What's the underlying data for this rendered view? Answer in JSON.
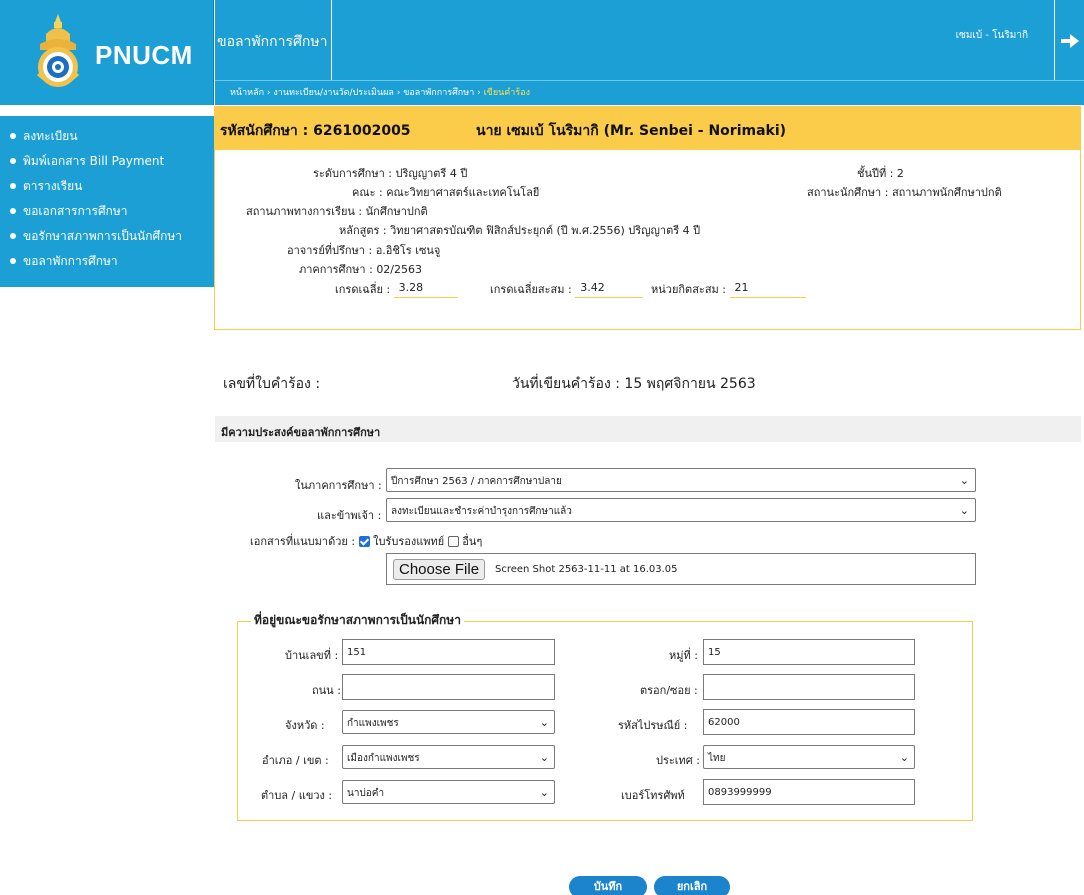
{
  "app": {
    "logo_text": "PNUCM",
    "page_title": "ขอลาพักการศึกษา",
    "user_name": "เซมเบ้ - โนริมากิ"
  },
  "breadcrumb": {
    "items": [
      "หน้าหลัก",
      "งานทะเบียน/งานวัด/ประเมินผล",
      "ขอลาพักการศึกษา"
    ],
    "separator": "›",
    "current": "เขียนคำร้อง"
  },
  "sidebar": {
    "items": [
      {
        "label": "ลงทะเบียน"
      },
      {
        "label": "พิมพ์เอกสาร Bill Payment"
      },
      {
        "label": "ตารางเรียน"
      },
      {
        "label": "ขอเอกสารการศึกษา"
      },
      {
        "label": "ขอรักษาสภาพการเป็นนักศึกษา"
      },
      {
        "label": "ขอลาพักการศึกษา"
      }
    ]
  },
  "student": {
    "id_label": "รหัสนักศึกษา : ",
    "id": "6261002005",
    "name": "นาย เซมเบ้ โนริมากิ (Mr. Senbei - Norimaki)",
    "level_label": "ระดับการศึกษา :",
    "level": "ปริญญาตรี 4 ปี",
    "faculty_label": "คณะ :",
    "faculty": "คณะวิทยาศาสตร์และเทคโนโลยี",
    "study_status_label": "สถานภาพทางการเรียน :",
    "study_status": "นักศึกษาปกติ",
    "curriculum_label": "หลักสูตร :",
    "curriculum": "วิทยาศาสตรบัณฑิต ฟิสิกส์ประยุกต์ (ปี พ.ศ.2556) ปริญญาตรี 4 ปี",
    "advisor_label": "อาจารย์ที่ปรึกษา :",
    "advisor": "อ.อิชิโร เซนจู",
    "semester_label": "ภาคการศึกษา :",
    "semester": "02/2563",
    "year_label": "ชั้นปีที่ :",
    "year": "2",
    "student_status_label": "สถานะนักศึกษา :",
    "student_status": "สถานภาพนักศึกษาปกติ",
    "gpa_label": "เกรดเฉลี่ย :",
    "gpa": "3.28",
    "gpax_label": "เกรดเฉลี่ยสะสม :",
    "gpax": "3.42",
    "credits_label": "หน่วยกิตสะสม :",
    "credits": "21"
  },
  "request": {
    "number_label": "เลขที่ใบคำร้อง :",
    "date_label": "วันที่เขียนคำร้อง :",
    "date": "15 พฤศจิกายน 2563",
    "purpose_title": "มีความประสงค์ขอลาพักการศึกษา",
    "semester_label": "ในภาคการศึกษา :",
    "semester_value": "ปีการศึกษา 2563 / ภาคการศึกษาปลาย",
    "status_label": "และข้าพเจ้า :",
    "status_value": "ลงทะเบียนและชำระค่าบำรุงการศึกษาแล้ว",
    "docs_label": "เอกสารที่แนบมาด้วย :",
    "doc_medical": "ใบรับรองแพทย์",
    "doc_other": "อื่นๆ",
    "file_button": "Choose File",
    "file_name": "Screen Shot 2563-11-11 at 16.03.05"
  },
  "address": {
    "legend": "ที่อยู่ขณะขอรักษาสภาพการเป็นนักศึกษา",
    "house_no_label": "บ้านเลขที่ :",
    "house_no": "151",
    "moo_label": "หมู่ที่ :",
    "moo": "15",
    "road_label": "ถนน :",
    "road": "",
    "soi_label": "ตรอก/ซอย :",
    "soi": "",
    "province_label": "จังหวัด :",
    "province": "กำแพงเพชร",
    "postcode_label": "รหัสไปรษณีย์ :",
    "postcode": "62000",
    "district_label": "อำเภอ / เขต :",
    "district": "เมืองกำแพงเพชร",
    "country_label": "ประเทศ :",
    "country": "ไทย",
    "subdistrict_label": "ตำบล / แขวง :",
    "subdistrict": "นาบ่อคำ",
    "phone_label": "เบอร์โทรศัพท์",
    "phone": "0893999999"
  },
  "actions": {
    "save": "บันทึก",
    "cancel": "ยกเลิก"
  },
  "colors": {
    "primary_blue": "#1b9fd5",
    "accent_yellow": "#fbcb4a",
    "button_blue": "#1b84cc"
  }
}
